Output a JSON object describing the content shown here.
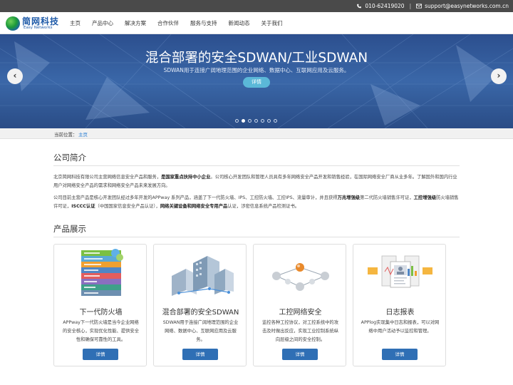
{
  "topbar": {
    "phone": "010-62419020",
    "separator": "|",
    "email": "support@easynetworks.com.cn"
  },
  "logo": {
    "cn": "简网科技",
    "en": "Easy Networks"
  },
  "nav": [
    "主页",
    "产品中心",
    "解决方案",
    "合作伙伴",
    "服务与支持",
    "新闻动态",
    "关于我们"
  ],
  "banner": {
    "title": "混合部署的安全SDWAN/工业SDWAN",
    "subtitle": "SDWAN用于连接广阔地理范围的企业网络、数据中心、互联网应用及云服务。",
    "button": "详情",
    "prev": "‹",
    "next": "›",
    "slide_count": 7,
    "active_slide": 2
  },
  "breadcrumb": {
    "label": "当前位置：",
    "home": "主页"
  },
  "about": {
    "title": "公司简介",
    "p1": [
      {
        "t": "北京简网科技有限公司主营网络信息安全产品和服务，",
        "b": false
      },
      {
        "t": "是国家重点扶持中小企业",
        "b": true
      },
      {
        "t": "。公司核心开发团队和管理人员具有多年网络安全产品开发和销售经验，在国际网络安全厂商从业多年。了解国外和国内行业用户对网络安全产品的需求和网络安全产品未来发展方向。",
        "b": false
      }
    ],
    "p2": [
      {
        "t": "公司目前主营产品是核心开发团队经过多年开发的APPway 系列产品，涵盖了下一代防火墙、IPS、工控防火墙、工控IPS、流量审计，并且获得",
        "b": false
      },
      {
        "t": "万兆增强级",
        "b": true
      },
      {
        "t": "第二代防火墙销售许可证，",
        "b": false
      },
      {
        "t": "工控增强级",
        "b": true
      },
      {
        "t": "防火墙销售许可证，",
        "b": false
      },
      {
        "t": "ISCCC认证",
        "b": true
      },
      {
        "t": "（中国国家信息安全产品认证），",
        "b": false
      },
      {
        "t": "网络关键设备和网络安全专用产品",
        "b": true
      },
      {
        "t": "认证，涉密信息系统产品检测证书。",
        "b": false
      }
    ]
  },
  "products": {
    "title": "产品展示",
    "items": [
      {
        "title": "下一代防火墙",
        "desc": "APPway下一代防火墙是当今企业网络的安全核心，实现优化性能、提供安全性和确保可靠性的工具。",
        "button": "详情",
        "icon": "osi-layer-stack-icon"
      },
      {
        "title": "混合部署的安全SDWAN",
        "desc": "SDWAN用于连接广阔地理范围的企业网络、数据中心、互联网应用及云服务。",
        "button": "详情",
        "icon": "network-buildings-icon"
      },
      {
        "title": "工控网络安全",
        "desc": "监控各种工控协议，对工控系统中的攻击及时做出反应，实现工业控制系统纵向层级之间的安全控制。",
        "button": "详情",
        "icon": "industrial-network-icon"
      },
      {
        "title": "日志报表",
        "desc": "APPlog实现集中日志和报表，可以对网络中用户活动予以监控和管理。",
        "button": "详情",
        "icon": "report-documents-icon"
      }
    ]
  },
  "colors": {
    "accent": "#2f6fb5",
    "topbar": "#4a4a4a",
    "banner": "#3a67a8",
    "link": "#2a7fd4"
  }
}
